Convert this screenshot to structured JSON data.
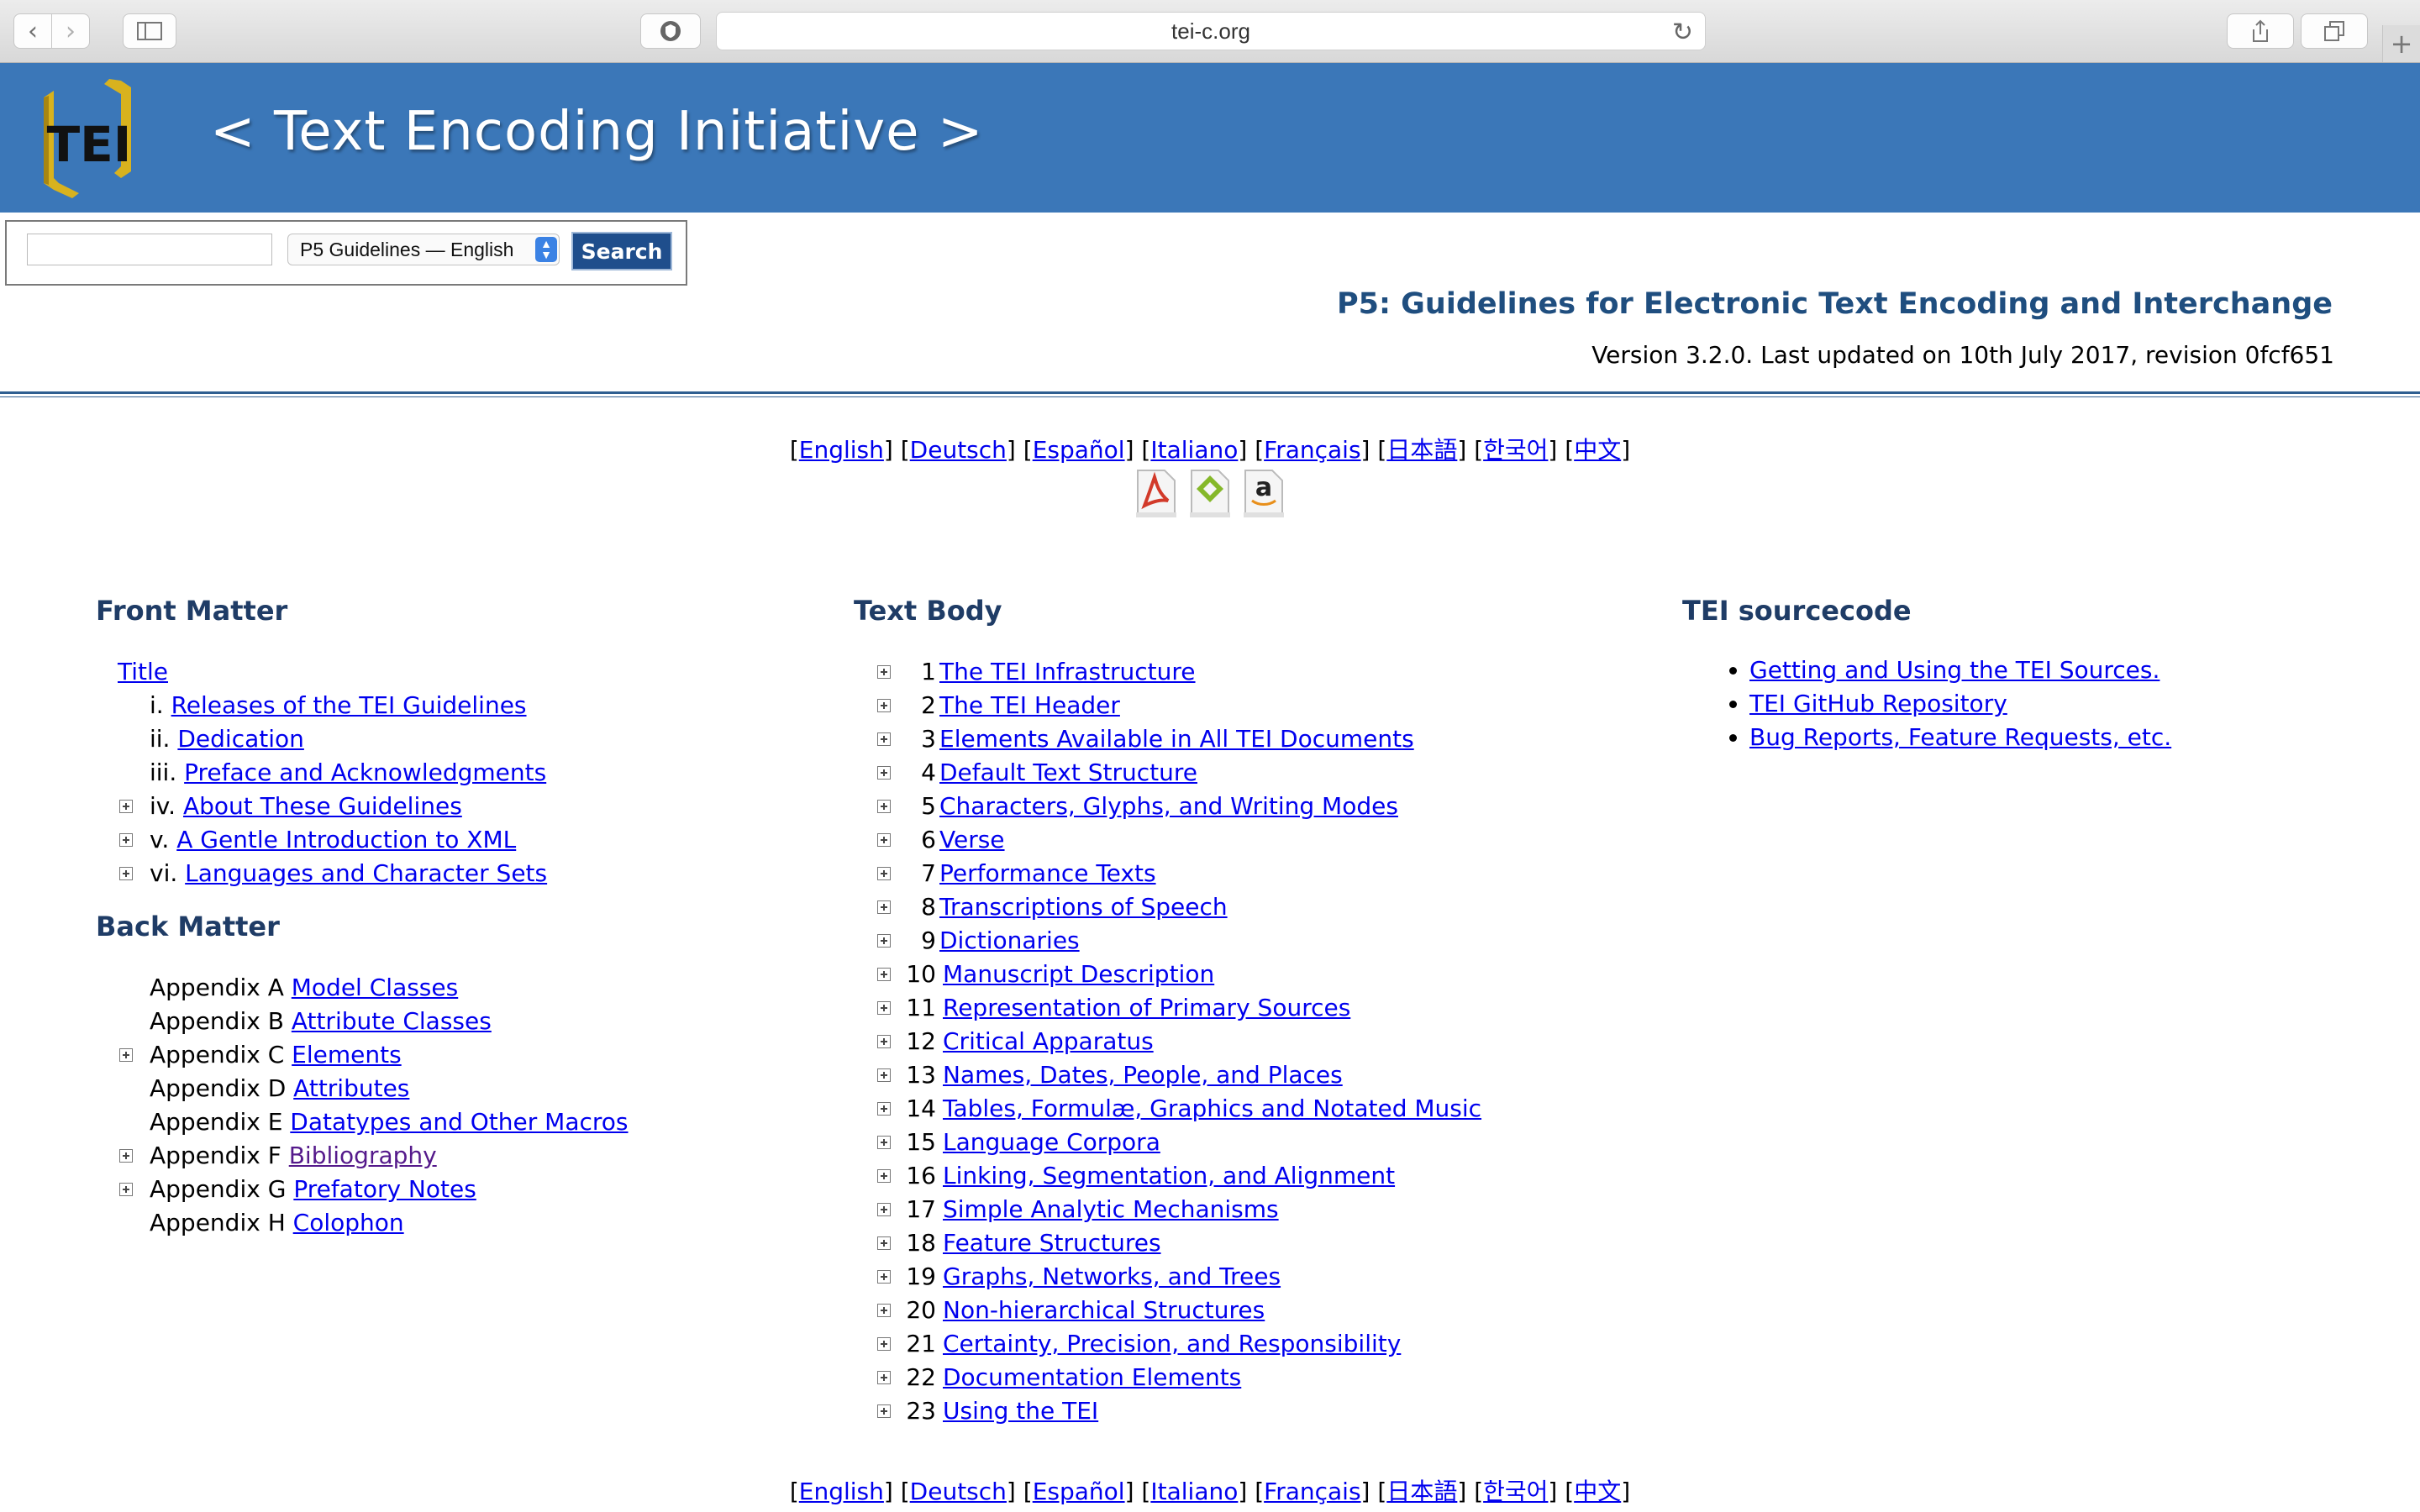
{
  "browser": {
    "url": "tei-c.org",
    "back_icon": "chevron-left-icon",
    "forward_icon": "chevron-right-icon",
    "sidebar_icon": "sidebar-icon",
    "privacy_icon": "shield-icon",
    "reload_icon": "reload-icon",
    "share_icon": "share-icon",
    "tabs_icon": "tabs-icon",
    "new_tab_icon": "plus-icon"
  },
  "banner": {
    "logo_text": "TEI",
    "title": "< Text Encoding Initiative >",
    "bg_color": "#3b77b8"
  },
  "search": {
    "input_value": "",
    "select_value": "P5 Guidelines — English",
    "button_label": "Search"
  },
  "header": {
    "title": "P5: Guidelines for Electronic Text Encoding and Interchange",
    "version": "Version 3.2.0. Last updated on 10th July 2017, revision 0fcf651"
  },
  "languages": [
    "English",
    "Deutsch",
    "Español",
    "Italiano",
    "Français",
    "日本語",
    "한국어",
    "中文"
  ],
  "download_icons": [
    "pdf-icon",
    "epub-icon",
    "amazon-icon"
  ],
  "front_matter": {
    "heading": "Front Matter",
    "title_link": "Title",
    "items": [
      {
        "num": "i.",
        "label": "Releases of the TEI Guidelines",
        "expandable": false
      },
      {
        "num": "ii.",
        "label": "Dedication",
        "expandable": false
      },
      {
        "num": "iii.",
        "label": "Preface and Acknowledgments",
        "expandable": false
      },
      {
        "num": "iv.",
        "label": "About These Guidelines",
        "expandable": true
      },
      {
        "num": "v.",
        "label": "A Gentle Introduction to XML",
        "expandable": true
      },
      {
        "num": "vi.",
        "label": "Languages and Character Sets",
        "expandable": true
      }
    ]
  },
  "back_matter": {
    "heading": "Back Matter",
    "items": [
      {
        "num": "Appendix A",
        "label": "Model Classes",
        "expandable": false
      },
      {
        "num": "Appendix B",
        "label": "Attribute Classes",
        "expandable": false
      },
      {
        "num": "Appendix C",
        "label": "Elements",
        "expandable": true
      },
      {
        "num": "Appendix D",
        "label": "Attributes",
        "expandable": false
      },
      {
        "num": "Appendix E",
        "label": "Datatypes and Other Macros",
        "expandable": false
      },
      {
        "num": "Appendix F",
        "label": "Bibliography",
        "expandable": true
      },
      {
        "num": "Appendix G",
        "label": "Prefatory Notes",
        "expandable": true
      },
      {
        "num": "Appendix H",
        "label": "Colophon",
        "expandable": false
      }
    ]
  },
  "text_body": {
    "heading": "Text Body",
    "items": [
      {
        "num": "1",
        "label": "The TEI Infrastructure"
      },
      {
        "num": "2",
        "label": "The TEI Header"
      },
      {
        "num": "3",
        "label": "Elements Available in All TEI Documents"
      },
      {
        "num": "4",
        "label": "Default Text Structure"
      },
      {
        "num": "5",
        "label": "Characters, Glyphs, and Writing Modes"
      },
      {
        "num": "6",
        "label": "Verse"
      },
      {
        "num": "7",
        "label": "Performance Texts"
      },
      {
        "num": "8",
        "label": "Transcriptions of Speech"
      },
      {
        "num": "9",
        "label": "Dictionaries"
      },
      {
        "num": "10",
        "label": "Manuscript Description"
      },
      {
        "num": "11",
        "label": "Representation of Primary Sources"
      },
      {
        "num": "12",
        "label": "Critical Apparatus"
      },
      {
        "num": "13",
        "label": "Names, Dates, People, and Places"
      },
      {
        "num": "14",
        "label": "Tables, Formulæ, Graphics and Notated Music"
      },
      {
        "num": "15",
        "label": "Language Corpora"
      },
      {
        "num": "16",
        "label": "Linking, Segmentation, and Alignment"
      },
      {
        "num": "17",
        "label": "Simple Analytic Mechanisms"
      },
      {
        "num": "18",
        "label": "Feature Structures"
      },
      {
        "num": "19",
        "label": "Graphs, Networks, and Trees"
      },
      {
        "num": "20",
        "label": "Non-hierarchical Structures"
      },
      {
        "num": "21",
        "label": "Certainty, Precision, and Responsibility"
      },
      {
        "num": "22",
        "label": "Documentation Elements"
      },
      {
        "num": "23",
        "label": "Using the TEI"
      }
    ]
  },
  "sourcecode": {
    "heading": "TEI sourcecode",
    "items": [
      "Getting and Using the TEI Sources.",
      "TEI GitHub Repository",
      "Bug Reports, Feature Requests, etc."
    ]
  }
}
